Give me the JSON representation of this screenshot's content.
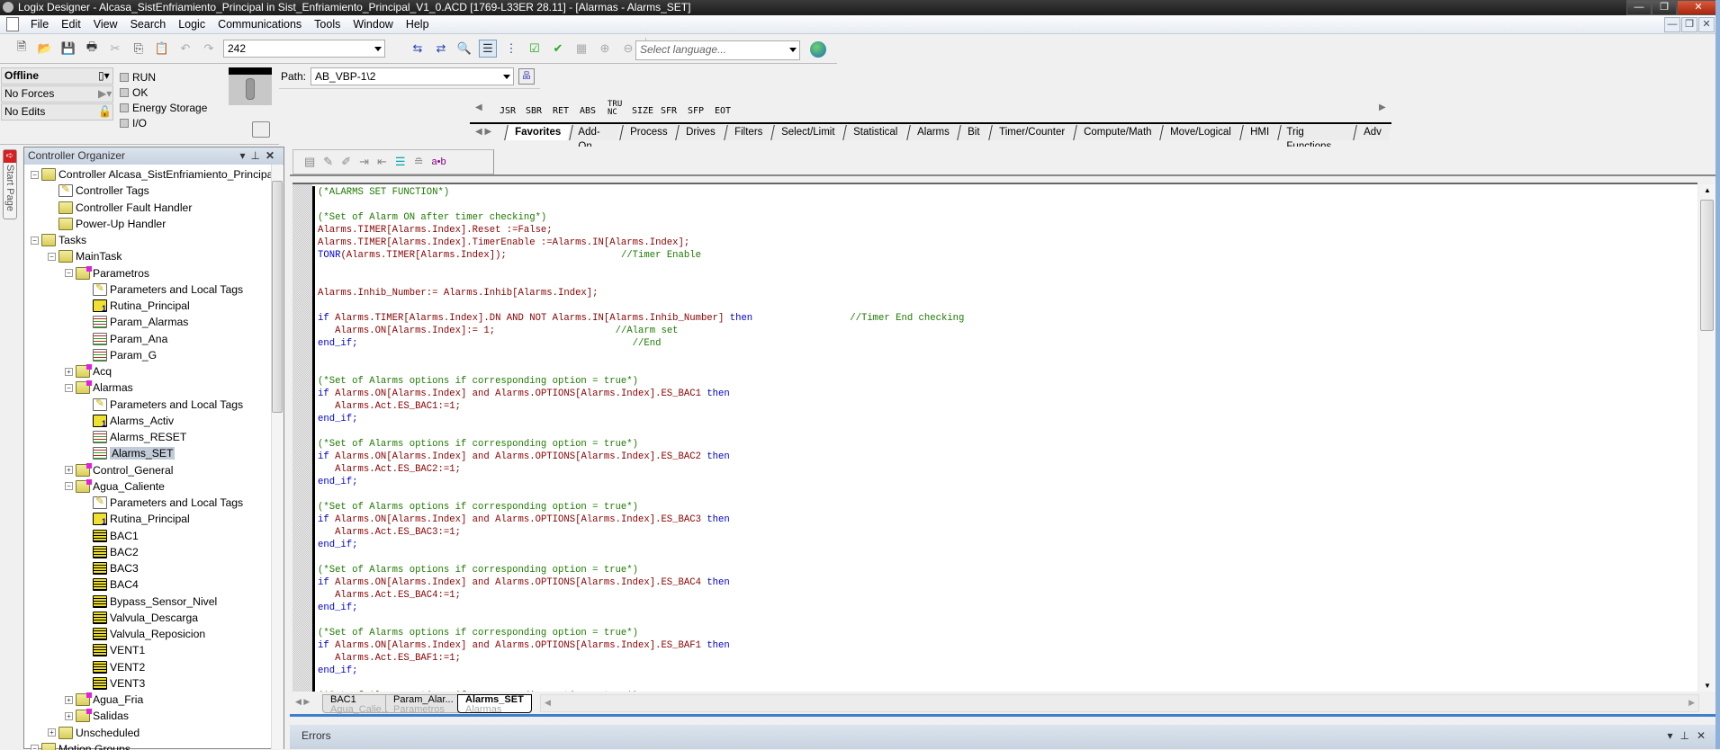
{
  "window": {
    "title": "Logix Designer - Alcasa_SistEnfriamiento_Principal in Sist_Enfriamiento_Principal_V1_0.ACD [1769-L33ER 28.11] - [Alarmas - Alarms_SET]",
    "controls": {
      "minimize": "—",
      "restore": "❐",
      "close": "✕"
    }
  },
  "menu": [
    "File",
    "Edit",
    "View",
    "Search",
    "Logic",
    "Communications",
    "Tools",
    "Window",
    "Help"
  ],
  "toolbar": {
    "combo_value": "242",
    "language_placeholder": "Select language..."
  },
  "status": {
    "mode": "Offline",
    "forces": "No Forces",
    "edits": "No Edits",
    "indicators": [
      "RUN",
      "OK",
      "Energy Storage",
      "I/O"
    ]
  },
  "path": {
    "label": "Path:",
    "value": "AB_VBP-1\\2"
  },
  "instructions": {
    "buttons": [
      "JSR",
      "SBR",
      "RET",
      "ABS",
      "TRU NC",
      "SIZE",
      "SFR",
      "SFP",
      "EOT"
    ],
    "tabs": [
      "Favorites",
      "Add-On",
      "Process",
      "Drives",
      "Filters",
      "Select/Limit",
      "Statistical",
      "Alarms",
      "Bit",
      "Timer/Counter",
      "Compute/Math",
      "Move/Logical",
      "HMI",
      "Trig Functions",
      "Adv"
    ],
    "active_tab": "Favorites"
  },
  "start_page": {
    "label": "Start Page"
  },
  "organizer": {
    "title": "Controller Organizer",
    "items": [
      {
        "label": "Controller Alcasa_SistEnfriamiento_Principa",
        "level": 0,
        "icon": "folder",
        "expand": "-"
      },
      {
        "label": "Controller Tags",
        "level": 1,
        "icon": "tags"
      },
      {
        "label": "Controller Fault Handler",
        "level": 1,
        "icon": "folder"
      },
      {
        "label": "Power-Up Handler",
        "level": 1,
        "icon": "folder"
      },
      {
        "label": "Tasks",
        "level": 0,
        "icon": "folder",
        "expand": "-"
      },
      {
        "label": "MainTask",
        "level": 1,
        "icon": "folder",
        "expand": "-"
      },
      {
        "label": "Parametros",
        "level": 2,
        "icon": "prog",
        "expand": "-"
      },
      {
        "label": "Parameters and Local Tags",
        "level": 3,
        "icon": "tags"
      },
      {
        "label": "Rutina_Principal",
        "level": 3,
        "icon": "fbd"
      },
      {
        "label": "Param_Alarmas",
        "level": 3,
        "icon": "st"
      },
      {
        "label": "Param_Ana",
        "level": 3,
        "icon": "st"
      },
      {
        "label": "Param_G",
        "level": 3,
        "icon": "st"
      },
      {
        "label": "Acq",
        "level": 2,
        "icon": "prog",
        "expand": "+"
      },
      {
        "label": "Alarmas",
        "level": 2,
        "icon": "prog",
        "expand": "-"
      },
      {
        "label": "Parameters and Local Tags",
        "level": 3,
        "icon": "tags"
      },
      {
        "label": "Alarms_Activ",
        "level": 3,
        "icon": "fbd"
      },
      {
        "label": "Alarms_RESET",
        "level": 3,
        "icon": "st"
      },
      {
        "label": "Alarms_SET",
        "level": 3,
        "icon": "st",
        "selected": true
      },
      {
        "label": "Control_General",
        "level": 2,
        "icon": "prog",
        "expand": "+"
      },
      {
        "label": "Agua_Caliente",
        "level": 2,
        "icon": "prog",
        "expand": "-"
      },
      {
        "label": "Parameters and Local Tags",
        "level": 3,
        "icon": "tags"
      },
      {
        "label": "Rutina_Principal",
        "level": 3,
        "icon": "fbd"
      },
      {
        "label": "BAC1",
        "level": 3,
        "icon": "lad"
      },
      {
        "label": "BAC2",
        "level": 3,
        "icon": "lad"
      },
      {
        "label": "BAC3",
        "level": 3,
        "icon": "lad"
      },
      {
        "label": "BAC4",
        "level": 3,
        "icon": "lad"
      },
      {
        "label": "Bypass_Sensor_Nivel",
        "level": 3,
        "icon": "lad"
      },
      {
        "label": "Valvula_Descarga",
        "level": 3,
        "icon": "lad"
      },
      {
        "label": "Valvula_Reposicion",
        "level": 3,
        "icon": "lad"
      },
      {
        "label": "VENT1",
        "level": 3,
        "icon": "lad"
      },
      {
        "label": "VENT2",
        "level": 3,
        "icon": "lad"
      },
      {
        "label": "VENT3",
        "level": 3,
        "icon": "lad"
      },
      {
        "label": "Agua_Fria",
        "level": 2,
        "icon": "prog",
        "expand": "+"
      },
      {
        "label": "Salidas",
        "level": 2,
        "icon": "prog",
        "expand": "+"
      },
      {
        "label": "Unscheduled",
        "level": 1,
        "icon": "folder",
        "expand": "+"
      },
      {
        "label": "Motion Groups",
        "level": 0,
        "icon": "folder",
        "expand": "-"
      }
    ]
  },
  "editor": {
    "format_button": "a•b",
    "lines": [
      [
        [
          "cm",
          "(*ALARMS SET FUNCTION*)"
        ]
      ],
      [],
      [
        [
          "cm",
          "(*Set of Alarm ON after timer checking*)"
        ]
      ],
      [
        [
          "id",
          "Alarms.TIMER[Alarms.Index].Reset :=False;"
        ]
      ],
      [
        [
          "id",
          "Alarms.TIMER[Alarms.Index].TimerEnable :=Alarms.IN[Alarms.Index];"
        ]
      ],
      [
        [
          "kw",
          "TONR"
        ],
        [
          "id",
          "(Alarms.TIMER[Alarms.Index]);"
        ],
        [
          "tx",
          "                    "
        ],
        [
          "cm",
          "//Timer Enable"
        ]
      ],
      [],
      [],
      [
        [
          "id",
          "Alarms.Inhib_Number:= Alarms.Inhib[Alarms.Index];"
        ]
      ],
      [],
      [
        [
          "kw",
          "if "
        ],
        [
          "id",
          "Alarms.TIMER[Alarms.Index].DN AND NOT Alarms.IN[Alarms.Inhib_Number] "
        ],
        [
          "kw",
          "then"
        ],
        [
          "tx",
          "                 "
        ],
        [
          "cm",
          "//Timer End checking"
        ]
      ],
      [
        [
          "tx",
          "   "
        ],
        [
          "id",
          "Alarms.ON[Alarms.Index]:= 1;"
        ],
        [
          "tx",
          "                     "
        ],
        [
          "cm",
          "//Alarm set"
        ]
      ],
      [
        [
          "kw",
          "end_if;"
        ],
        [
          "tx",
          "                                                "
        ],
        [
          "cm",
          "//End"
        ]
      ],
      [],
      [],
      [
        [
          "cm",
          "(*Set of Alarms options if corresponding option = true*)"
        ]
      ],
      [
        [
          "kw",
          "if "
        ],
        [
          "id",
          "Alarms.ON[Alarms.Index] and Alarms.OPTIONS[Alarms.Index].ES_BAC1 "
        ],
        [
          "kw",
          "then"
        ]
      ],
      [
        [
          "tx",
          "   "
        ],
        [
          "id",
          "Alarms.Act.ES_BAC1:=1;"
        ]
      ],
      [
        [
          "kw",
          "end_if;"
        ]
      ],
      [],
      [
        [
          "cm",
          "(*Set of Alarms options if corresponding option = true*)"
        ]
      ],
      [
        [
          "kw",
          "if "
        ],
        [
          "id",
          "Alarms.ON[Alarms.Index] and Alarms.OPTIONS[Alarms.Index].ES_BAC2 "
        ],
        [
          "kw",
          "then"
        ]
      ],
      [
        [
          "tx",
          "   "
        ],
        [
          "id",
          "Alarms.Act.ES_BAC2:=1;"
        ]
      ],
      [
        [
          "kw",
          "end_if;"
        ]
      ],
      [],
      [
        [
          "cm",
          "(*Set of Alarms options if corresponding option = true*)"
        ]
      ],
      [
        [
          "kw",
          "if "
        ],
        [
          "id",
          "Alarms.ON[Alarms.Index] and Alarms.OPTIONS[Alarms.Index].ES_BAC3 "
        ],
        [
          "kw",
          "then"
        ]
      ],
      [
        [
          "tx",
          "   "
        ],
        [
          "id",
          "Alarms.Act.ES_BAC3:=1;"
        ]
      ],
      [
        [
          "kw",
          "end_if;"
        ]
      ],
      [],
      [
        [
          "cm",
          "(*Set of Alarms options if corresponding option = true*)"
        ]
      ],
      [
        [
          "kw",
          "if "
        ],
        [
          "id",
          "Alarms.ON[Alarms.Index] and Alarms.OPTIONS[Alarms.Index].ES_BAC4 "
        ],
        [
          "kw",
          "then"
        ]
      ],
      [
        [
          "tx",
          "   "
        ],
        [
          "id",
          "Alarms.Act.ES_BAC4:=1;"
        ]
      ],
      [
        [
          "kw",
          "end_if;"
        ]
      ],
      [],
      [
        [
          "cm",
          "(*Set of Alarms options if corresponding option = true*)"
        ]
      ],
      [
        [
          "kw",
          "if "
        ],
        [
          "id",
          "Alarms.ON[Alarms.Index] and Alarms.OPTIONS[Alarms.Index].ES_BAF1 "
        ],
        [
          "kw",
          "then"
        ]
      ],
      [
        [
          "tx",
          "   "
        ],
        [
          "id",
          "Alarms.Act.ES_BAF1:=1;"
        ]
      ],
      [
        [
          "kw",
          "end_if;"
        ]
      ],
      [],
      [
        [
          "cm",
          "(*Set of Alarms options if corresponding option = true*)"
        ]
      ]
    ]
  },
  "doc_tabs": [
    {
      "title": "BAC1",
      "sub": "Agua_Calie..."
    },
    {
      "title": "Param_Alar...",
      "sub": "Parametros"
    },
    {
      "title": "Alarms_SET",
      "sub": "Alarmas",
      "active": true
    }
  ],
  "errors_panel": {
    "title": "Errors"
  }
}
